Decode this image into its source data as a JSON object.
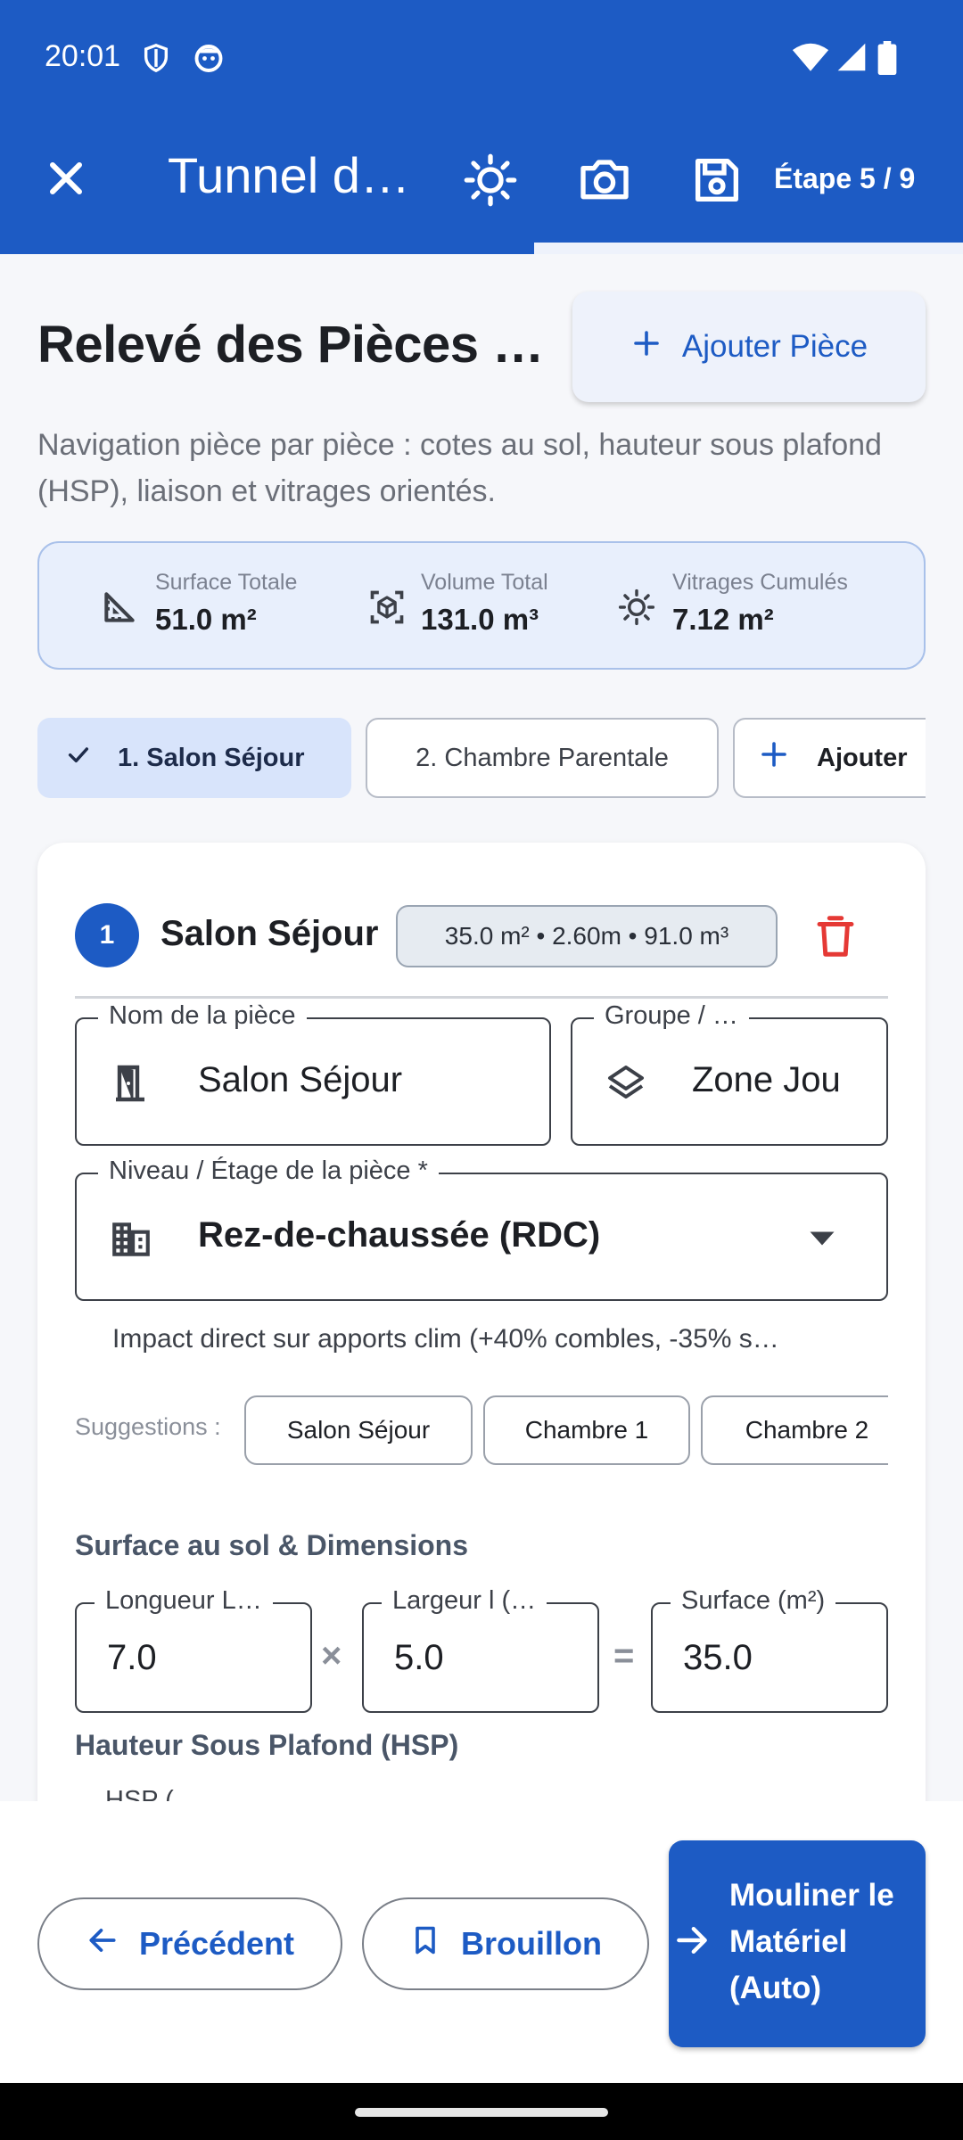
{
  "status_bar": {
    "time": "20:01",
    "icons": [
      "shield-icon",
      "face-icon",
      "wifi-icon",
      "signal-icon",
      "battery-icon"
    ]
  },
  "toolbar": {
    "title": "Tunnel d…",
    "step": "Étape 5 / 9",
    "progress": 0.555,
    "icons": [
      "close-icon",
      "sun-icon",
      "camera-icon",
      "save-icon"
    ]
  },
  "header": {
    "title": "Relevé des Pièces …",
    "add_room_label": "Ajouter Pièce",
    "subtitle": "Navigation pièce par pièce : cotes au sol, hauteur sous plafond (HSP), liaison et vitrages orientés."
  },
  "stats": [
    {
      "label": "Surface Totale",
      "value": "51.0 m²",
      "icon": "area-icon"
    },
    {
      "label": "Volume Total",
      "value": "131.0 m³",
      "icon": "cube-icon"
    },
    {
      "label": "Vitrages Cumulés",
      "value": "7.12 m²",
      "icon": "sun-icon"
    }
  ],
  "room_tabs": [
    {
      "label": "1. Salon Séjour",
      "active": true
    },
    {
      "label": "2. Chambre Parentale",
      "active": false
    },
    {
      "label": "Ajouter",
      "active": false
    }
  ],
  "room": {
    "number": "1",
    "name": "Salon Séjour",
    "badge": "35.0 m² • 2.60m • 91.0 m³",
    "name_field": {
      "label": "Nom de la pièce",
      "value": "Salon Séjour"
    },
    "group_field": {
      "label": "Groupe / …",
      "value": "Zone Jou"
    },
    "level_field": {
      "label": "Niveau / Étage de la pièce *",
      "value": "Rez-de-chaussée (RDC)"
    },
    "level_helper": "Impact direct sur apports clim (+40% combles, -35% s…",
    "suggestions_label": "Suggestions :",
    "suggestions": [
      "Salon Séjour",
      "Chambre 1",
      "Chambre 2"
    ],
    "surface_section": "Surface au sol & Dimensions",
    "length_field": {
      "label": "Longueur L…",
      "value": "7.0"
    },
    "width_field": {
      "label": "Largeur l (…",
      "value": "5.0"
    },
    "surface_field": {
      "label": "Surface (m²)",
      "value": "35.0"
    },
    "times_sign": "×",
    "equals_sign": "=",
    "hsp_section": "Hauteur Sous Plafond (HSP)",
    "hsp_field": {
      "label": "HSP (…"
    }
  },
  "bottom": {
    "prev_label": "Précédent",
    "draft_label": "Brouillon",
    "auto_label": "Mouliner le Matériel (Auto)"
  },
  "colors": {
    "primary": "#1d5bc4",
    "stats_bg": "#e8effc",
    "danger": "#e53935"
  }
}
